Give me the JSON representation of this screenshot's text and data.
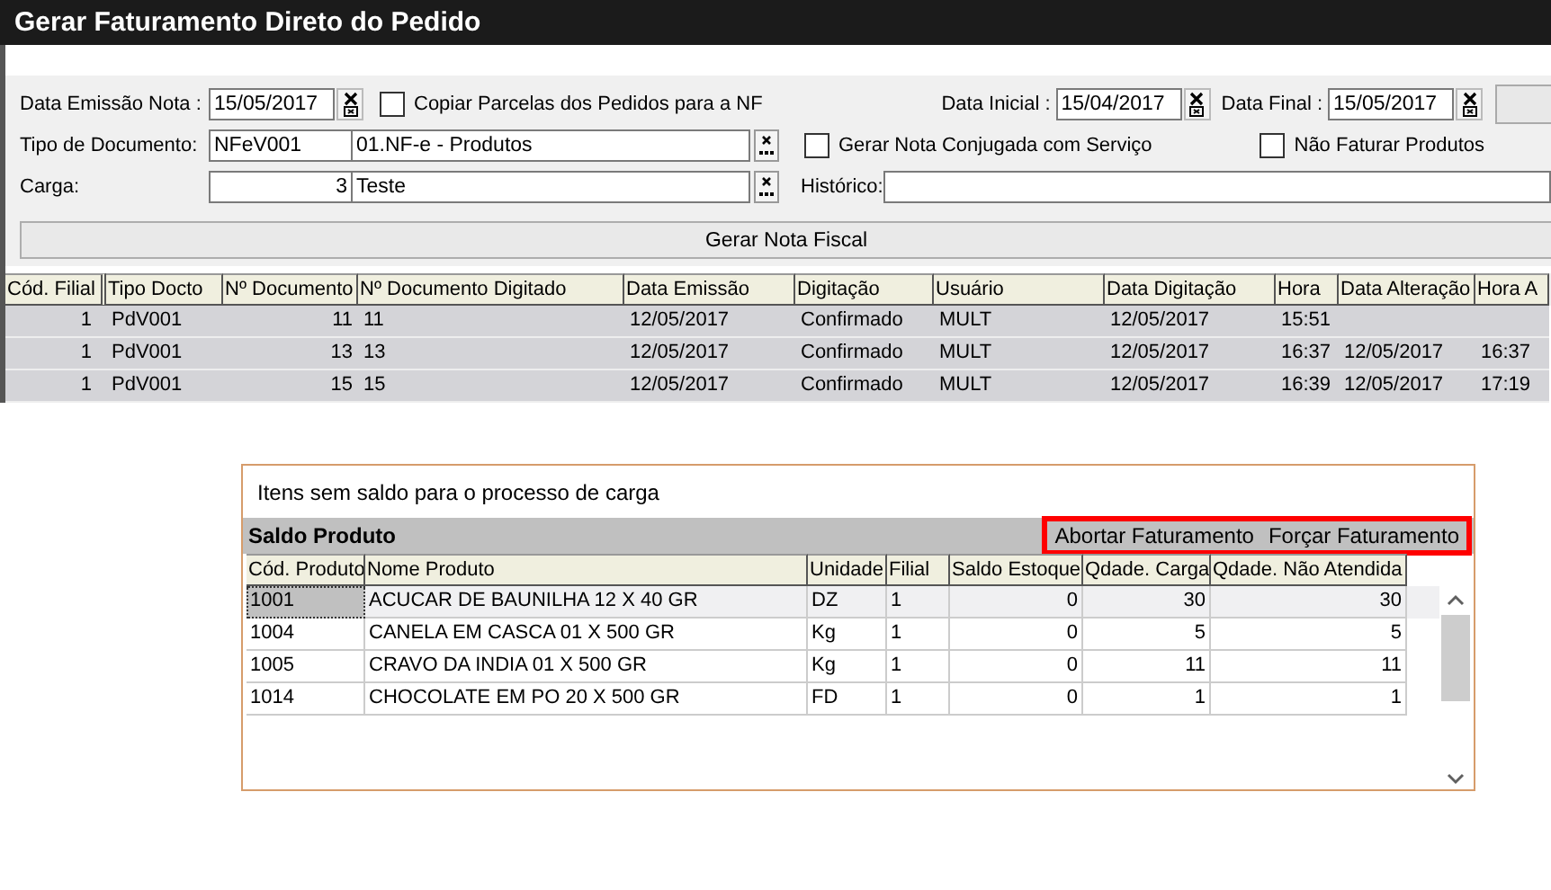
{
  "window": {
    "title": "Gerar Faturamento Direto do Pedido"
  },
  "form": {
    "data_emissao": {
      "label": "Data Emissão Nota :",
      "value": "15/05/2017"
    },
    "copiar_parcelas": {
      "label": "Copiar Parcelas dos Pedidos para a NF",
      "checked": false
    },
    "data_inicial": {
      "label": "Data Inicial :",
      "value": "15/04/2017"
    },
    "data_final": {
      "label": "Data Final :",
      "value": "15/05/2017"
    },
    "tipo_documento": {
      "label": "Tipo de Documento:",
      "code": "NFeV001",
      "description": "01.NF-e - Produtos"
    },
    "gerar_conjugada": {
      "label": "Gerar Nota Conjugada com Serviço",
      "checked": false
    },
    "nao_faturar": {
      "label": "Não Faturar Produtos",
      "checked": false
    },
    "carga": {
      "label": "Carga:",
      "code": "3",
      "description": "Teste"
    },
    "historico": {
      "label": "Histórico:"
    },
    "generate_button": "Gerar Nota Fiscal"
  },
  "table": {
    "columns": [
      "Cód. Filial",
      "Tipo Docto",
      "Nº Documento",
      "Nº Documento Digitado",
      "Data Emissão",
      "Digitação",
      "Usuário",
      "Data Digitação",
      "Hora",
      "Data Alteração",
      "Hora A"
    ],
    "rows": [
      [
        "1",
        "PdV001",
        "11",
        "11",
        "12/05/2017",
        "Confirmado",
        "MULT",
        "12/05/2017",
        "15:51",
        null,
        null
      ],
      [
        "1",
        "PdV001",
        "13",
        "13",
        "12/05/2017",
        "Confirmado",
        "MULT",
        "12/05/2017",
        "16:37",
        "12/05/2017",
        "16:37"
      ],
      [
        "1",
        "PdV001",
        "15",
        "15",
        "12/05/2017",
        "Confirmado",
        "MULT",
        "12/05/2017",
        "16:39",
        "12/05/2017",
        "17:19"
      ]
    ]
  },
  "dialog": {
    "message": "Itens sem saldo para o processo de carga",
    "section_title": "Saldo Produto",
    "actions": {
      "highlighted": true,
      "buttons": [
        "Abortar Faturamento",
        "Forçar Faturamento"
      ]
    },
    "columns": [
      "Cód. Produto",
      "Nome Produto",
      "Unidade",
      "Filial",
      "Saldo Estoque",
      "Qdade. Carga",
      "Qdade. Não Atendida"
    ],
    "rows": [
      {
        "selected": true,
        "cells": [
          "1001",
          "ACUCAR DE BAUNILHA 12 X 40 GR",
          "DZ",
          "1",
          "0",
          "30",
          "30"
        ]
      },
      {
        "selected": false,
        "cells": [
          "1004",
          "CANELA EM CASCA 01 X 500 GR",
          "Kg",
          "1",
          "0",
          "5",
          "5"
        ]
      },
      {
        "selected": false,
        "cells": [
          "1005",
          "CRAVO DA INDIA 01 X 500 GR",
          "Kg",
          "1",
          "0",
          "11",
          "11"
        ]
      },
      {
        "selected": false,
        "cells": [
          "1014",
          "CHOCOLATE EM PO 20 X 500 GR",
          "FD",
          "1",
          "0",
          "1",
          "1"
        ]
      }
    ]
  }
}
